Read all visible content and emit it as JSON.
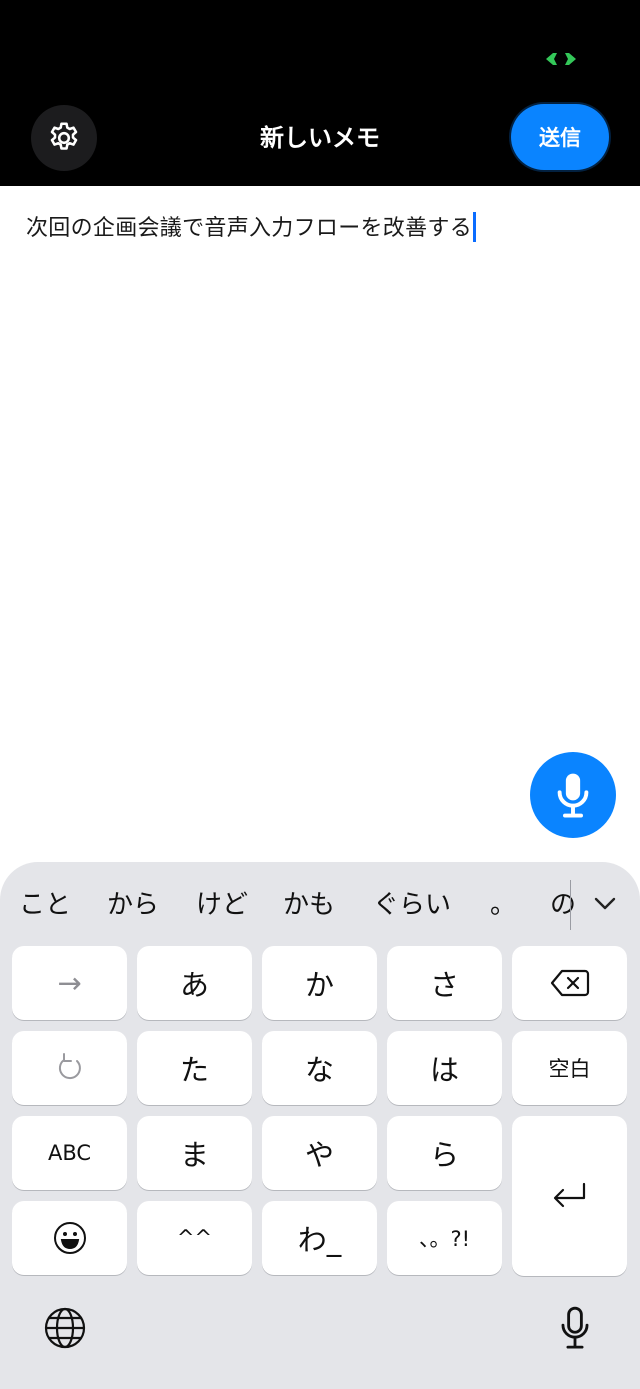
{
  "header": {
    "title": "新しいメモ",
    "send_label": "送信",
    "accent_color": "#0a84ff",
    "status_indicator_color": "#34c759"
  },
  "note": {
    "text": "次回の企画会議で音声入力フローを改善する"
  },
  "icons": {
    "settings": "gear-icon",
    "mic_fab": "microphone-icon",
    "globe": "globe-icon",
    "dictation": "microphone-icon"
  },
  "keyboard": {
    "suggestions": [
      "こと",
      "から",
      "けど",
      "かも",
      "ぐらい",
      "。",
      "の"
    ],
    "keys": {
      "arrow": "→",
      "a": "あ",
      "ka": "か",
      "sa": "さ",
      "ta": "た",
      "na": "な",
      "ha": "は",
      "space": "空白",
      "abc": "ABC",
      "ma": "ま",
      "ya": "や",
      "ra": "ら",
      "emoticon": "^^",
      "wa": "わ_",
      "punct": "、。?!"
    }
  }
}
